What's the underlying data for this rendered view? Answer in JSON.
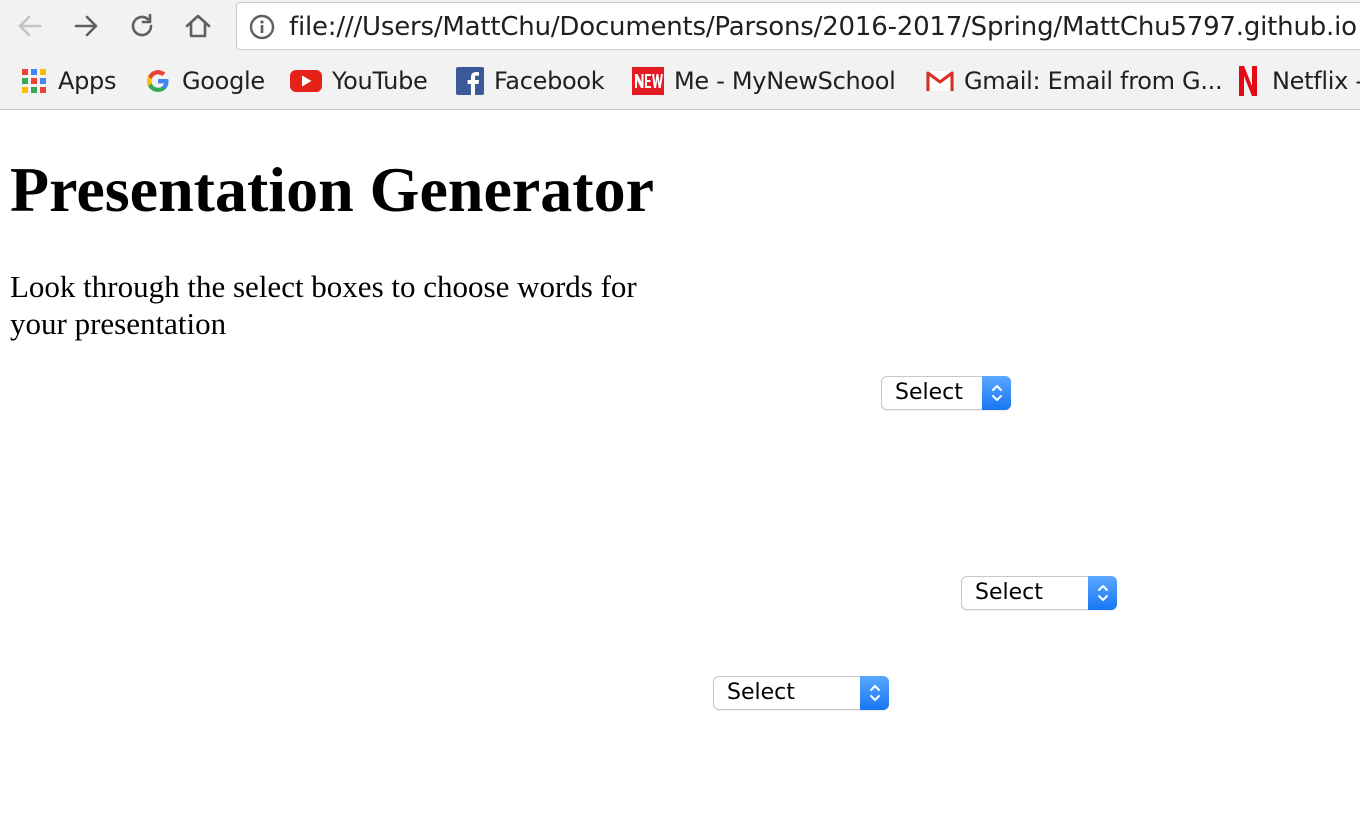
{
  "browser": {
    "url": "file:///Users/MattChu/Documents/Parsons/2016-2017/Spring/MattChu5797.github.io",
    "bookmarks": [
      {
        "label": "Apps",
        "icon": "apps-grid-icon"
      },
      {
        "label": "Google",
        "icon": "google-icon"
      },
      {
        "label": "YouTube",
        "icon": "youtube-icon"
      },
      {
        "label": "Facebook",
        "icon": "facebook-icon"
      },
      {
        "label": "Me - MyNewSchool",
        "icon": "newschool-icon"
      },
      {
        "label": "Gmail: Email from G...",
        "icon": "gmail-icon"
      },
      {
        "label": "Netflix -",
        "icon": "netflix-icon"
      }
    ]
  },
  "page": {
    "title": "Presentation Generator",
    "instructions": "Look through the select boxes to choose words for your presentation",
    "selects": [
      {
        "value": "Select"
      },
      {
        "value": "Select"
      },
      {
        "value": "Select"
      }
    ]
  },
  "colors": {
    "select_accent": "#1776f5",
    "youtube": "#e62117",
    "facebook": "#3b5998",
    "netflix": "#e50914"
  }
}
